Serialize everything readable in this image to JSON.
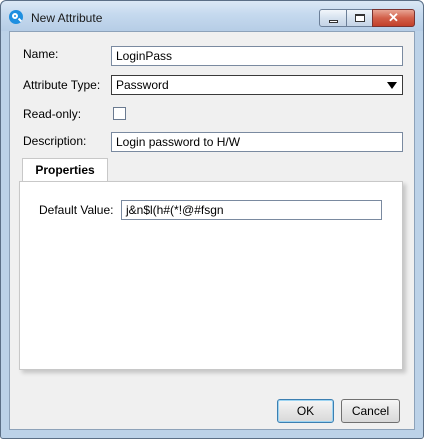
{
  "window": {
    "title": "New Attribute"
  },
  "form": {
    "name_label": "Name:",
    "name_value": "LoginPass",
    "type_label": "Attribute Type:",
    "type_value": "Password",
    "readonly_label": "Read-only:",
    "readonly_checked": false,
    "description_label": "Description:",
    "description_value": "Login password to H/W"
  },
  "properties": {
    "tab_label": "Properties",
    "default_value_label": "Default Value:",
    "default_value": "j&n$l(h#(*!@#fsgn"
  },
  "buttons": {
    "ok": "OK",
    "cancel": "Cancel"
  },
  "icons": {
    "app": "app-logo-icon",
    "minimize": "minimize-icon",
    "maximize": "maximize-icon",
    "close": "close-icon",
    "dropdown": "chevron-down-icon"
  },
  "colors": {
    "close_button": "#c2402a",
    "titlebar": "#c5d9ee",
    "focus_border": "#3c7fb1"
  }
}
